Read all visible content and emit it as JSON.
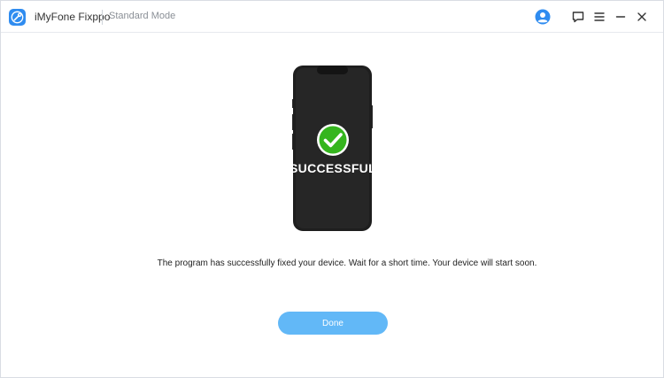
{
  "header": {
    "app_name": "iMyFone Fixppo",
    "mode": "Standard Mode",
    "icons": [
      "app-logo-icon",
      "user-avatar-icon",
      "feedback-icon",
      "menu-icon",
      "minimize-icon",
      "close-icon"
    ]
  },
  "main": {
    "status": "SUCCESSFUL",
    "message": "The program has successfully fixed your device. Wait for a short time. Your device will start soon.",
    "done_label": "Done"
  },
  "colors": {
    "accent": "#2f8cf0",
    "button": "#62b8f7",
    "success": "#35b51e",
    "phone": "#1e1e1e"
  }
}
